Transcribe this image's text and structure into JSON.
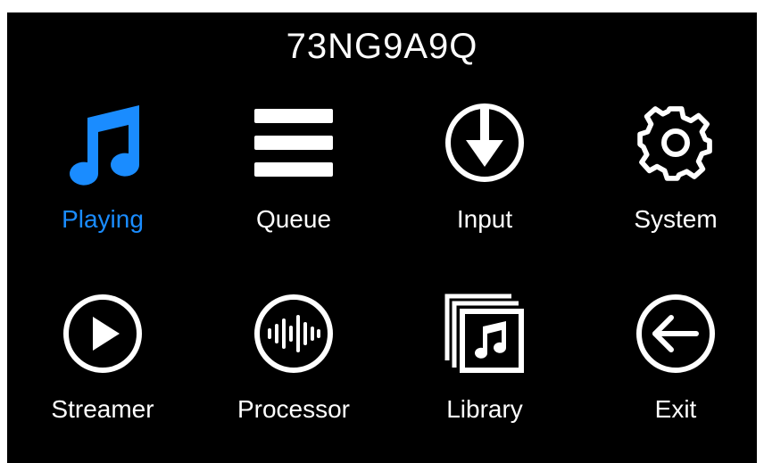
{
  "device_name": "73NG9A9Q",
  "accent_color": "#1a8cff",
  "menu": [
    {
      "label": "Playing",
      "icon": "music-note-icon",
      "active": true
    },
    {
      "label": "Queue",
      "icon": "list-icon",
      "active": false
    },
    {
      "label": "Input",
      "icon": "download-arrow-circle-icon",
      "active": false
    },
    {
      "label": "System",
      "icon": "gear-icon",
      "active": false
    },
    {
      "label": "Streamer",
      "icon": "play-circle-icon",
      "active": false
    },
    {
      "label": "Processor",
      "icon": "waveform-circle-icon",
      "active": false
    },
    {
      "label": "Library",
      "icon": "album-stack-icon",
      "active": false
    },
    {
      "label": "Exit",
      "icon": "back-arrow-circle-icon",
      "active": false
    }
  ]
}
